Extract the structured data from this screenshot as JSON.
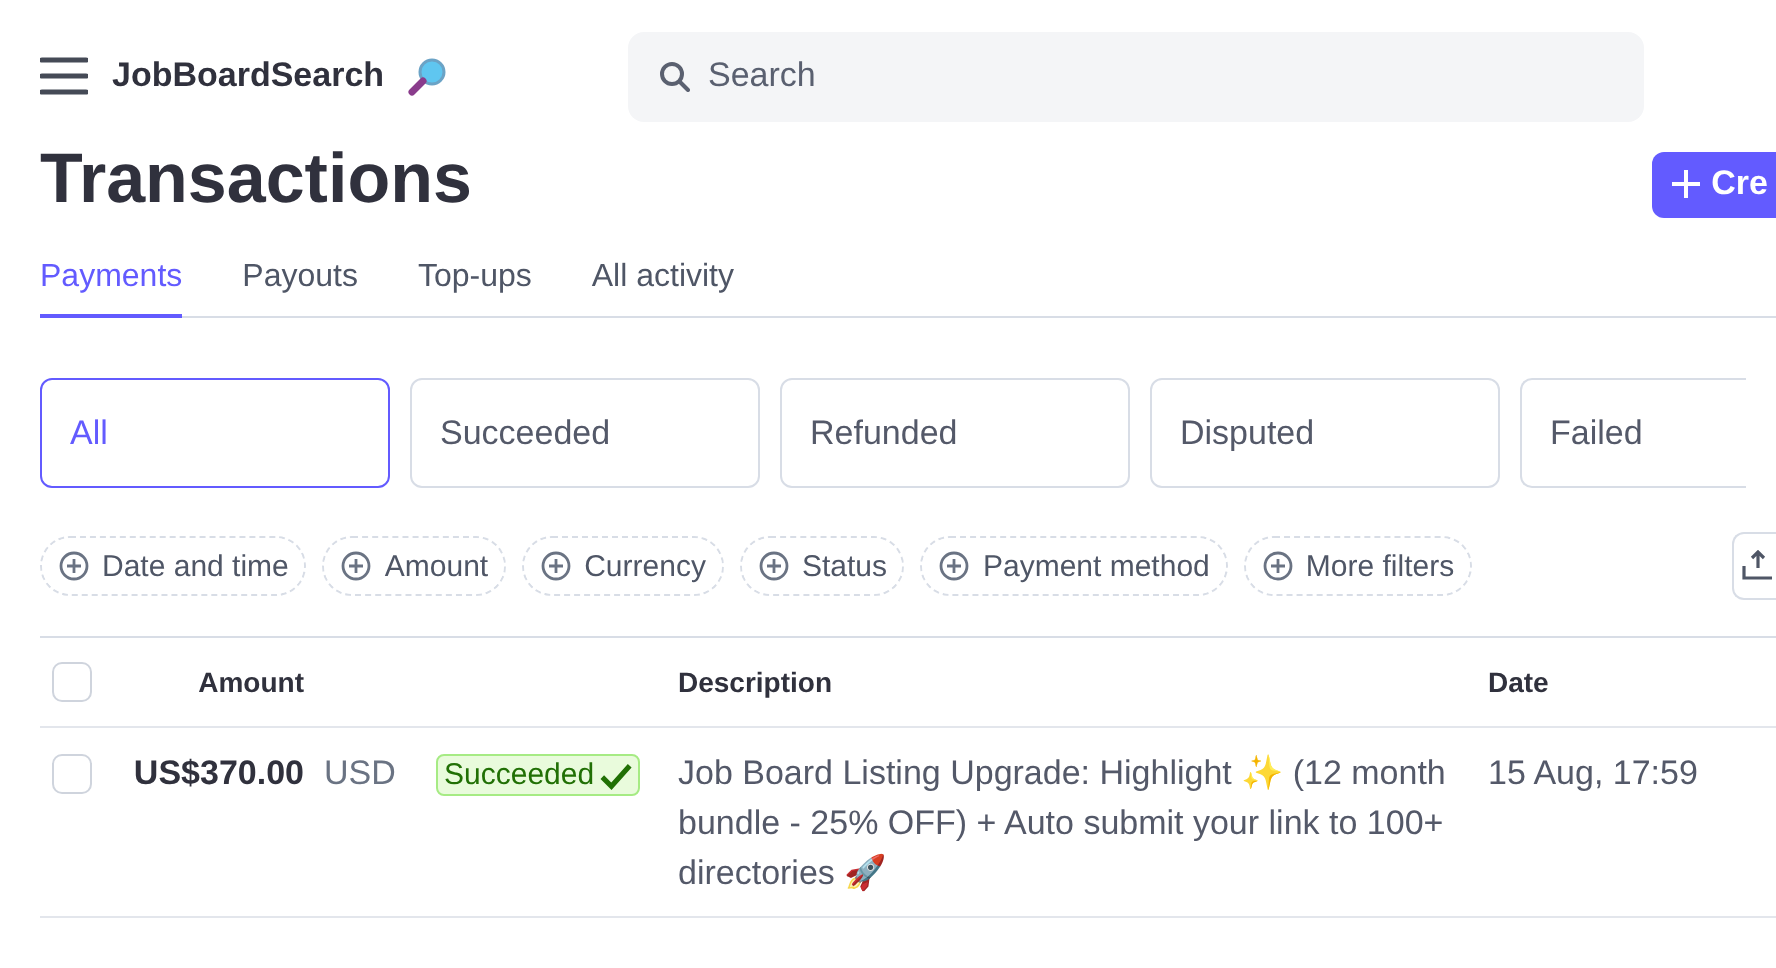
{
  "header": {
    "brand": "JobBoardSearch",
    "search": {
      "placeholder": "Search"
    }
  },
  "page": {
    "title": "Transactions",
    "create_button": "Cre"
  },
  "tabs": [
    {
      "label": "Payments",
      "selected": true
    },
    {
      "label": "Payouts",
      "selected": false
    },
    {
      "label": "Top-ups",
      "selected": false
    },
    {
      "label": "All activity",
      "selected": false
    }
  ],
  "status_filters": [
    {
      "label": "All",
      "selected": true
    },
    {
      "label": "Succeeded",
      "selected": false
    },
    {
      "label": "Refunded",
      "selected": false
    },
    {
      "label": "Disputed",
      "selected": false
    },
    {
      "label": "Failed",
      "selected": false
    }
  ],
  "filter_chips": [
    "Date and time",
    "Amount",
    "Currency",
    "Status",
    "Payment method",
    "More filters"
  ],
  "table": {
    "select_all_checked": false,
    "columns": [
      "Amount",
      "Description",
      "Date"
    ],
    "rows": [
      {
        "checked": false,
        "amount": "US$370.00",
        "currency": "USD",
        "status": "Succeeded",
        "description": "Job Board Listing Upgrade: Highlight ✨ (12 month bundle - 25% OFF) + Auto submit your link to 100+ directories 🚀",
        "date": "15 Aug, 17:59"
      }
    ]
  }
}
